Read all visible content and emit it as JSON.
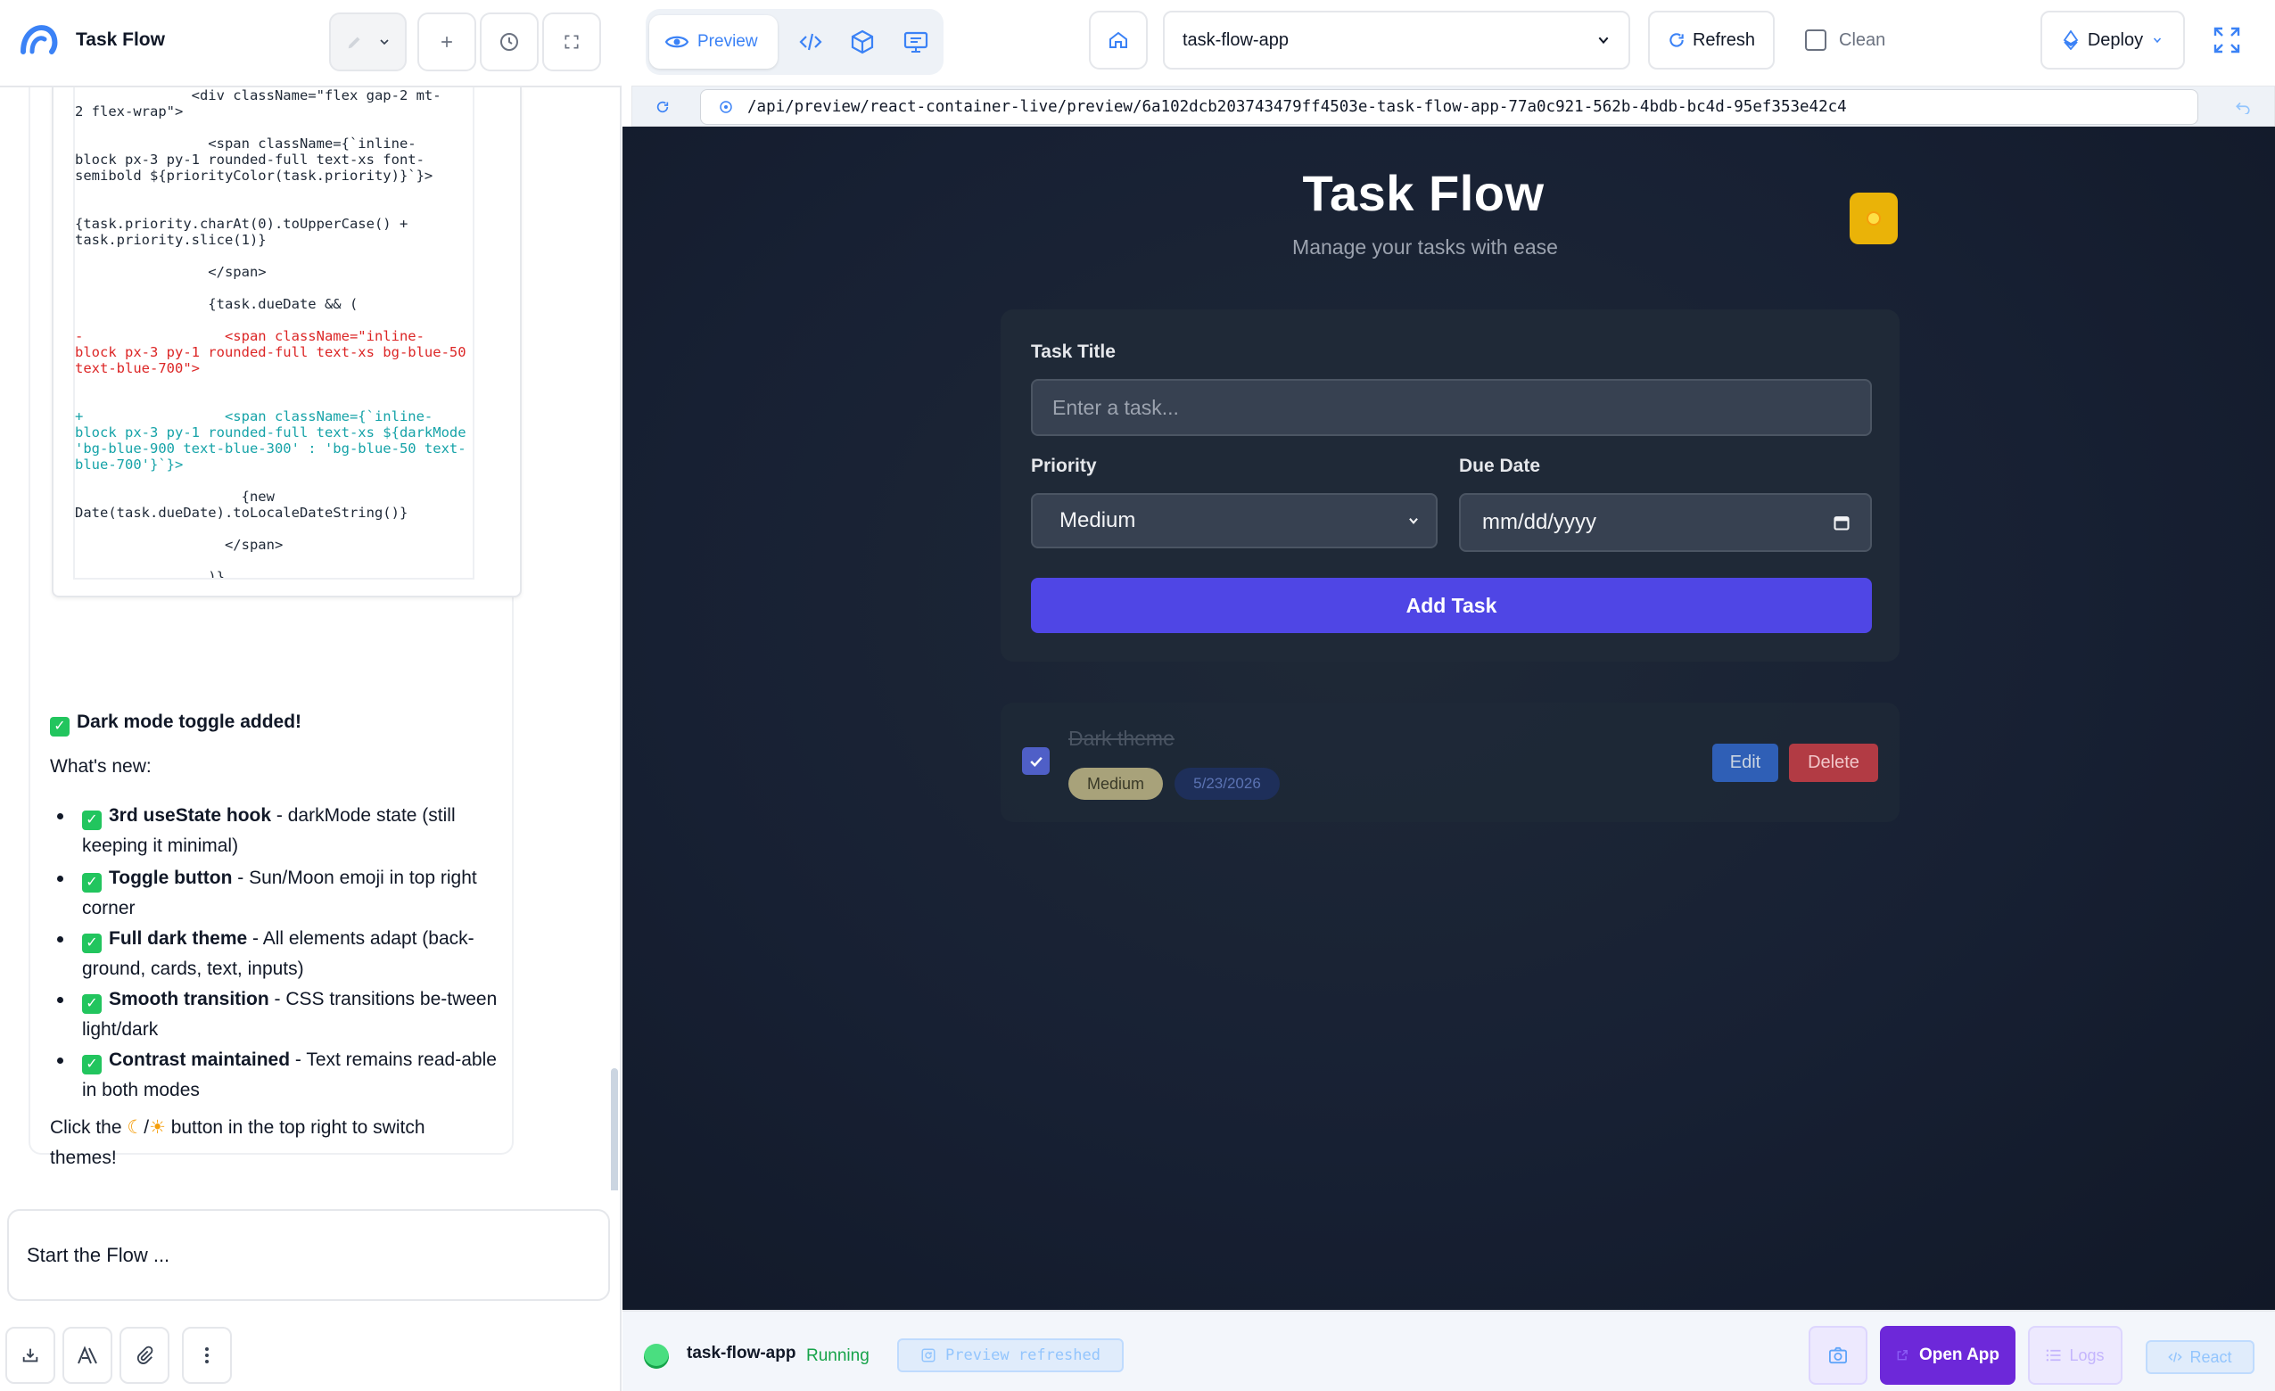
{
  "app": {
    "title": "Task Flow"
  },
  "chat": {
    "code_lines": [
      {
        "text": "              <div className=\"flex gap-2 mt-",
        "kind": "ctx"
      },
      {
        "text": "2 flex-wrap\">",
        "kind": "ctx"
      },
      {
        "text": "",
        "kind": "ctx"
      },
      {
        "text": "                <span className={`inline-",
        "kind": "ctx"
      },
      {
        "text": "block px-3 py-1 rounded-full text-xs font-",
        "kind": "ctx"
      },
      {
        "text": "semibold ${priorityColor(task.priority)}`}>",
        "kind": "ctx"
      },
      {
        "text": "",
        "kind": "ctx"
      },
      {
        "text": "",
        "kind": "ctx"
      },
      {
        "text": "{task.priority.charAt(0).toUpperCase() +",
        "kind": "ctx"
      },
      {
        "text": "task.priority.slice(1)}",
        "kind": "ctx"
      },
      {
        "text": "",
        "kind": "ctx"
      },
      {
        "text": "                </span>",
        "kind": "ctx"
      },
      {
        "text": "",
        "kind": "ctx"
      },
      {
        "text": "                {task.dueDate && (",
        "kind": "ctx"
      },
      {
        "text": "",
        "kind": "ctx"
      },
      {
        "text": "-                 <span className=\"inline-",
        "kind": "del"
      },
      {
        "text": "block px-3 py-1 rounded-full text-xs bg-blue-50",
        "kind": "del"
      },
      {
        "text": "text-blue-700\">",
        "kind": "del"
      },
      {
        "text": "",
        "kind": "ctx"
      },
      {
        "text": "",
        "kind": "ctx"
      },
      {
        "text": "+                 <span className={`inline-",
        "kind": "add"
      },
      {
        "text": "block px-3 py-1 rounded-full text-xs ${darkMode ?",
        "kind": "add"
      },
      {
        "text": "'bg-blue-900 text-blue-300' : 'bg-blue-50 text-",
        "kind": "add"
      },
      {
        "text": "blue-700'}`}>",
        "kind": "add"
      },
      {
        "text": "",
        "kind": "ctx"
      },
      {
        "text": "                    {new",
        "kind": "ctx"
      },
      {
        "text": "Date(task.dueDate).toLocaleDateString()}",
        "kind": "ctx"
      },
      {
        "text": "",
        "kind": "ctx"
      },
      {
        "text": "                  </span>",
        "kind": "ctx"
      },
      {
        "text": "",
        "kind": "ctx"
      },
      {
        "text": "                )}",
        "kind": "ctx"
      }
    ],
    "done_title": "Dark mode toggle added!",
    "whats_new": "What's new:",
    "features": [
      {
        "bold": "3rd useState hook",
        "rest": " - darkMode state (still keeping it minimal)"
      },
      {
        "bold": "Toggle button",
        "rest": " - Sun/Moon emoji in top right corner"
      },
      {
        "bold": "Full dark theme",
        "rest": " - All elements adapt (back-ground, cards, text, inputs)"
      },
      {
        "bold": "Smooth transition",
        "rest": " - CSS transitions be-tween light/dark"
      },
      {
        "bold": "Contrast maintained",
        "rest": " - Text remains read-able in both modes"
      }
    ],
    "click_note_pre": "Click the ",
    "click_note_mid": "/",
    "click_note_post": " button in the top right to switch themes!",
    "composer_placeholder": "Start the Flow ..."
  },
  "toolbar": {
    "preview_label": "Preview",
    "project": "task-flow-app",
    "refresh_label": "Refresh",
    "clean_label": "Clean",
    "deploy_label": "Deploy"
  },
  "address": {
    "url": "/api/preview/react-container-live/preview/6a102dcb203743479ff4503e-task-flow-app-77a0c921-562b-4bdb-bc4d-95ef353e42c4"
  },
  "preview": {
    "title": "Task Flow",
    "subtitle": "Manage your tasks with ease",
    "form": {
      "title_label": "Task Title",
      "title_placeholder": "Enter a task...",
      "priority_label": "Priority",
      "priority_value": "Medium",
      "due_label": "Due Date",
      "due_placeholder": "mm/dd/yyyy",
      "add_label": "Add Task"
    },
    "tasks": [
      {
        "title": "Dark theme",
        "priority": "Medium",
        "due": "5/23/2026",
        "done": true,
        "edit": "Edit",
        "delete": "Delete"
      }
    ]
  },
  "status": {
    "project": "task-flow-app",
    "state": "Running",
    "message": "Preview refreshed",
    "open_label": "Open App",
    "logs_label": "Logs",
    "framework": "React"
  },
  "colors": {
    "accent": "#4f46e5",
    "brand_blue": "#3b82f6",
    "running": "#16a34a",
    "open_app": "#6d28d9"
  }
}
